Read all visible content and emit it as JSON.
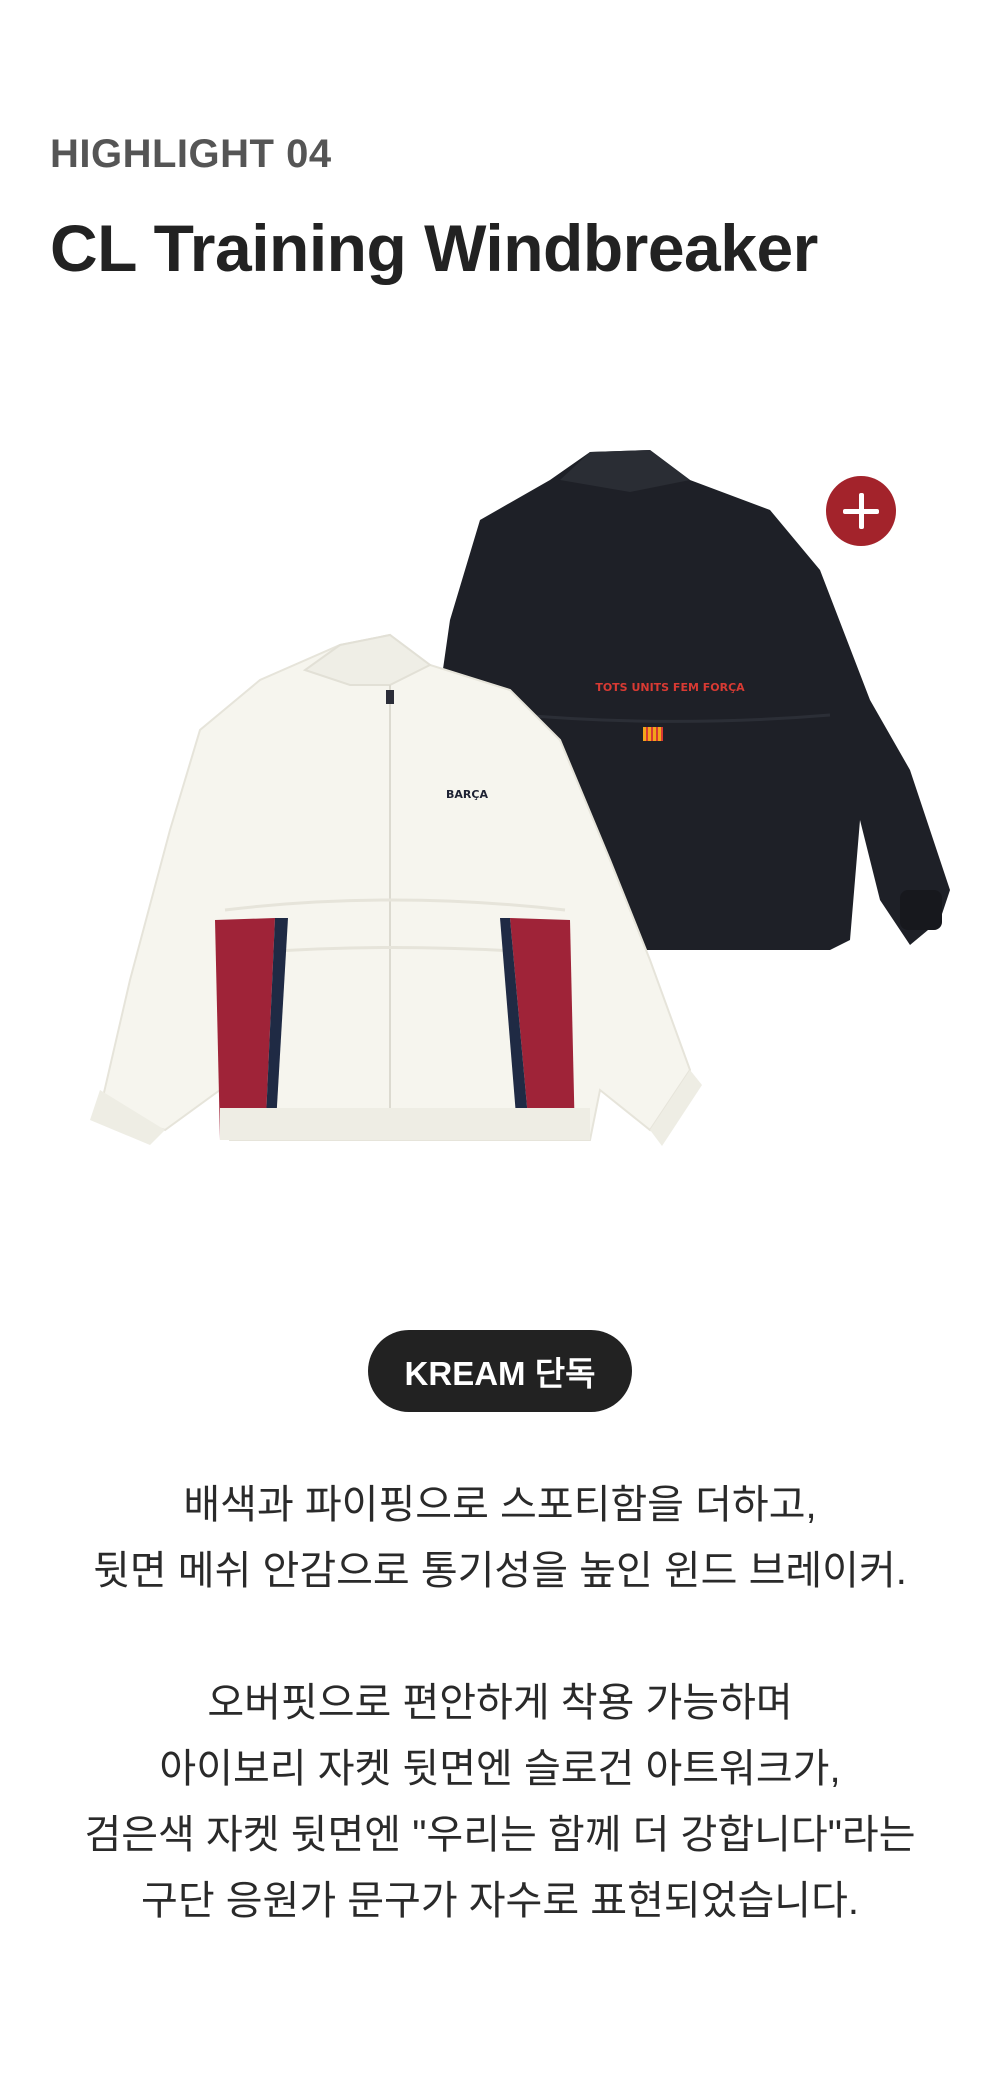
{
  "header": {
    "eyebrow": "HIGHLIGHT 04",
    "title": "CL Training Windbreaker"
  },
  "product": {
    "front_logo": "BARÇA",
    "back_text": "TOTS UNITS FEM FORÇA",
    "plus_icon": "plus-icon",
    "accent_color": "#a3232b"
  },
  "badge": {
    "label": "KREAM 단독"
  },
  "description": {
    "paragraph1": [
      "배색과 파이핑으로 스포티함을 더하고,",
      "뒷면 메쉬 안감으로 통기성을 높인 윈드 브레이커."
    ],
    "paragraph2": [
      "오버핏으로 편안하게 착용 가능하며",
      "아이보리 자켓 뒷면엔 슬로건 아트워크가,",
      "검은색 자켓 뒷면엔 \"우리는 함께 더 강합니다\"라는",
      "구단 응원가 문구가 자수로 표현되었습니다."
    ]
  }
}
